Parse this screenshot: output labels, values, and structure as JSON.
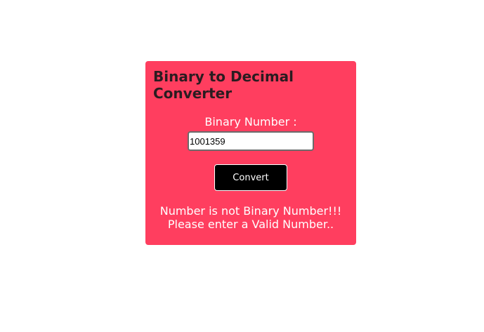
{
  "converter": {
    "title": "Binary to Decimal Converter",
    "input_label": "Binary Number :",
    "input_value": "1001359",
    "button_label": "Convert",
    "result_line1": "Number is not Binary Number!!!",
    "result_line2": "Please enter a Valid Number.."
  },
  "colors": {
    "card_background": "#ff3e5f",
    "title_text": "#2a1c20",
    "button_background": "#000000"
  }
}
